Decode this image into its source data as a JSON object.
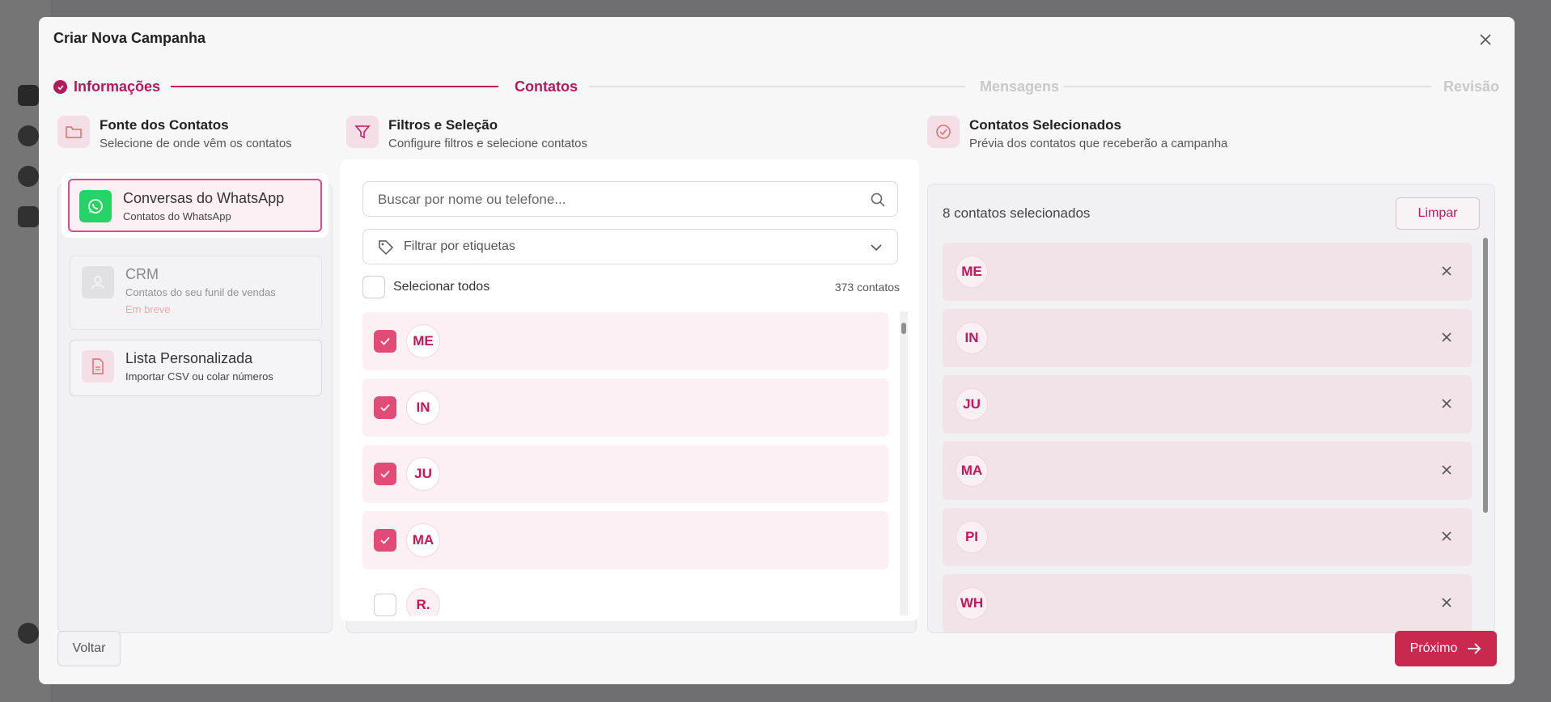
{
  "modal": {
    "title": "Criar Nova Campanha"
  },
  "stepper": {
    "steps": [
      {
        "label": "Informações",
        "state": "done"
      },
      {
        "label": "Contatos",
        "state": "active"
      },
      {
        "label": "Mensagens",
        "state": "pending"
      },
      {
        "label": "Revisão",
        "state": "pending"
      }
    ]
  },
  "source": {
    "title": "Fonte dos Contatos",
    "subtitle": "Selecione de onde vêm os contatos",
    "options": [
      {
        "title": "Conversas do WhatsApp",
        "subtitle": "Contatos do WhatsApp",
        "icon": "whatsapp-icon",
        "selected": true
      },
      {
        "title": "CRM",
        "subtitle": "Contatos do seu funil de vendas",
        "badge": "Em breve",
        "icon": "crm-icon",
        "disabled": true
      },
      {
        "title": "Lista Personalizada",
        "subtitle": "Importar CSV ou colar números",
        "icon": "file-icon"
      }
    ]
  },
  "filters": {
    "title": "Filtros e Seleção",
    "subtitle": "Configure filtros e selecione contatos",
    "search_placeholder": "Buscar por nome ou telefone...",
    "tags_placeholder": "Filtrar por etiquetas",
    "select_all_label": "Selecionar todos",
    "count_label": "373 contatos",
    "contacts": [
      {
        "initials": "ME",
        "checked": true
      },
      {
        "initials": "IN",
        "checked": true
      },
      {
        "initials": "JU",
        "checked": true
      },
      {
        "initials": "MA",
        "checked": true
      },
      {
        "initials": "R.",
        "checked": false
      }
    ]
  },
  "selected": {
    "title": "Contatos Selecionados",
    "subtitle": "Prévia dos contatos que receberão a campanha",
    "count_label": "8 contatos selecionados",
    "clear_label": "Limpar",
    "contacts": [
      "ME",
      "IN",
      "JU",
      "MA",
      "PI",
      "WH"
    ]
  },
  "footer": {
    "back_label": "Voltar",
    "next_label": "Próximo"
  },
  "colors": {
    "accent": "#c2185b",
    "whatsapp": "#25d366",
    "primary_button": "#c9284f"
  }
}
